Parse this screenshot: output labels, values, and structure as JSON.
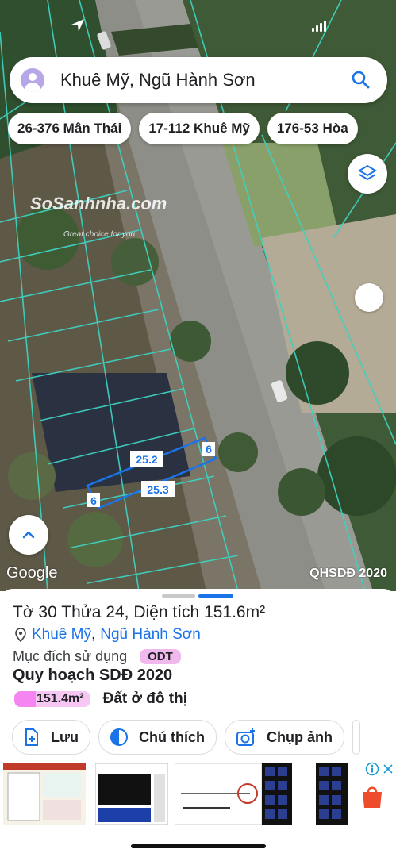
{
  "search": {
    "text": "Khuê Mỹ, Ngũ Hành Sơn"
  },
  "chips": [
    "26-376 Mân Thái",
    "17-112 Khuê Mỹ",
    "176-53 Hòa"
  ],
  "map": {
    "watermark": "SoSanhnha.com",
    "watermark_sub": "Great choice for you",
    "google_label": "Google",
    "layer_label": "QHSDĐ 2020",
    "dimensions": {
      "top": "25.2",
      "bottom": "25.3",
      "left": "6",
      "right": "6"
    }
  },
  "info": {
    "title": "Tờ 30 Thửa 24, Diện tích 151.6m²",
    "ward": "Khuê Mỹ",
    "district": "Ngũ Hành Sơn",
    "separator": ",",
    "purpose_label": "Mục đích sử dụng",
    "purpose_code": "ODT",
    "plan_title": "Quy hoạch SDĐ 2020",
    "plan_area": "151.4m²",
    "plan_use": "Đất ở đô thị"
  },
  "actions": [
    "Lưu",
    "Chú thích",
    "Chụp ảnh"
  ],
  "colors": {
    "accent": "#1a73e8",
    "odt": "#f0b8ec",
    "parcel": "#3fd1c0"
  }
}
